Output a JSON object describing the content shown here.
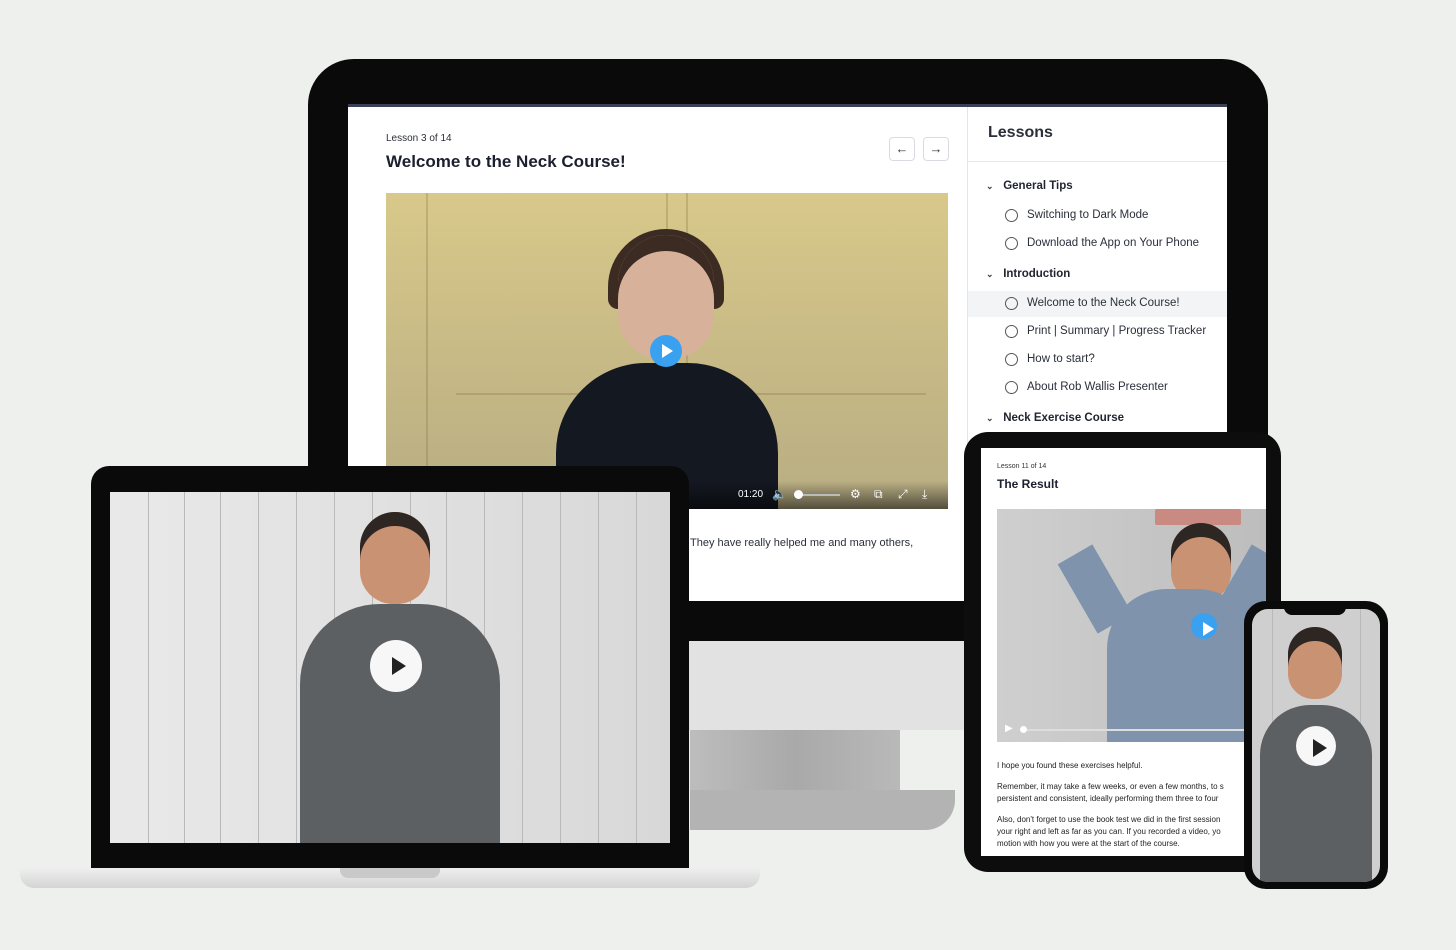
{
  "desktop": {
    "lesson_meta": "Lesson 3 of 14",
    "lesson_title": "Welcome to the Neck Course!",
    "nav": {
      "prev_icon": "arrow-left-icon",
      "next_icon": "arrow-right-icon"
    },
    "video": {
      "time": "01:20",
      "controls": [
        "volume-icon",
        "settings-icon",
        "popout-icon",
        "fullscreen-icon",
        "download-icon"
      ]
    },
    "body_text": "They have really helped me and many others,"
  },
  "sidebar": {
    "title": "Lessons",
    "sections": [
      {
        "label": "General Tips",
        "items": [
          "Switching to Dark Mode",
          "Download the App on Your Phone"
        ]
      },
      {
        "label": "Introduction",
        "items": [
          "Welcome to the Neck Course!",
          "Print | Summary | Progress Tracker",
          "How to start?",
          "About Rob Wallis Presenter"
        ]
      },
      {
        "label": "Neck Exercise Course",
        "items": []
      }
    ]
  },
  "tablet": {
    "lesson_meta": "Lesson 11 of 14",
    "lesson_title": "The Result",
    "paragraphs": [
      "I hope you found these exercises helpful.",
      "Remember, it may take a few weeks, or even a few months, to s",
      "persistent and consistent, ideally performing them three to four",
      "Also, don't forget to use the book test we did in the first session",
      "your right and left as far as you can. If you recorded a video, yo",
      "motion with how you were at the start of the course."
    ]
  },
  "colors": {
    "accent_play": "#3aa0f0",
    "background": "#edf0ec",
    "bezel": "#0a0a0a"
  }
}
